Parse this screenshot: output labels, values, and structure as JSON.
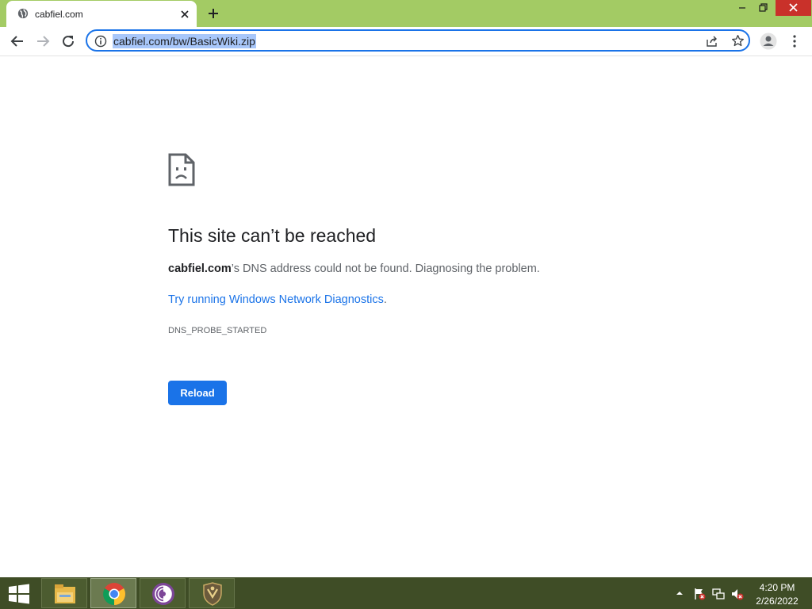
{
  "browser": {
    "tab": {
      "title": "cabfiel.com",
      "favicon": "globe-icon"
    },
    "address_bar": {
      "url": "cabfiel.com/bw/BasicWiki.zip"
    },
    "accent_color": "#1a73e8",
    "frame_color": "#a3cb64"
  },
  "error_page": {
    "icon": "sad-document-icon",
    "title": "This site can’t be reached",
    "domain": "cabfiel.com",
    "description_rest": "’s DNS address could not be found. Diagnosing the problem.",
    "link_text": "Try running Windows Network Diagnostics",
    "link_suffix": ".",
    "error_code": "DNS_PROBE_STARTED",
    "reload_label": "Reload"
  },
  "taskbar": {
    "apps": [
      "file-explorer-icon",
      "chrome-icon",
      "tor-browser-icon",
      "shield-app-icon"
    ],
    "active_app": "chrome-icon",
    "clock": {
      "time": "4:20 PM",
      "date": "2/26/2022"
    }
  }
}
